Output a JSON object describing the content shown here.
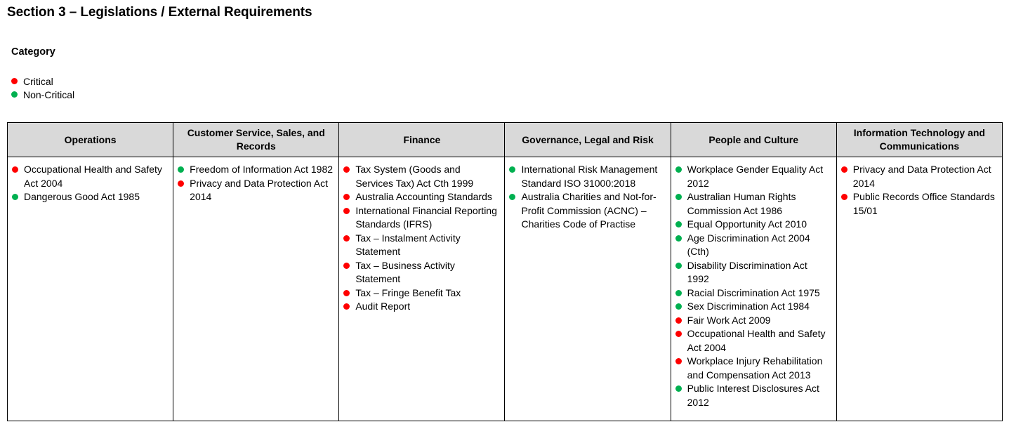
{
  "title": "Section 3 – Legislations / External Requirements",
  "category": {
    "label": "Category",
    "legend": [
      {
        "label": "Critical",
        "status": "critical",
        "color": "#ff0000"
      },
      {
        "label": "Non-Critical",
        "status": "non-critical",
        "color": "#00b050"
      }
    ]
  },
  "table": {
    "columns": [
      {
        "header": "Operations",
        "items": [
          {
            "text": "Occupational Health and Safety Act 2004",
            "status": "critical"
          },
          {
            "text": "Dangerous Good Act 1985",
            "status": "non-critical"
          }
        ]
      },
      {
        "header": "Customer Service, Sales, and Records",
        "items": [
          {
            "text": "Freedom of Information Act 1982",
            "status": "non-critical"
          },
          {
            "text": "Privacy and Data Protection Act 2014",
            "status": "critical"
          }
        ]
      },
      {
        "header": "Finance",
        "items": [
          {
            "text": "Tax System (Goods and Services Tax) Act Cth 1999",
            "status": "critical"
          },
          {
            "text": "Australia Accounting Standards",
            "status": "critical"
          },
          {
            "text": "International Financial Reporting Standards (IFRS)",
            "status": "critical"
          },
          {
            "text": "Tax – Instalment Activity Statement",
            "status": "critical"
          },
          {
            "text": "Tax – Business Activity Statement",
            "status": "critical"
          },
          {
            "text": "Tax – Fringe Benefit Tax",
            "status": "critical"
          },
          {
            "text": "Audit Report",
            "status": "critical"
          }
        ]
      },
      {
        "header": "Governance, Legal and Risk",
        "items": [
          {
            "text": "International Risk Management Standard ISO 31000:2018",
            "status": "non-critical"
          },
          {
            "text": "Australia Charities and Not-for-Profit Commission (ACNC) – Charities Code of Practise",
            "status": "non-critical"
          }
        ]
      },
      {
        "header": "People and Culture",
        "items": [
          {
            "text": "Workplace Gender Equality Act 2012",
            "status": "non-critical"
          },
          {
            "text": "Australian Human Rights Commission Act 1986",
            "status": "non-critical"
          },
          {
            "text": "Equal Opportunity Act 2010",
            "status": "non-critical"
          },
          {
            "text": "Age Discrimination Act 2004 (Cth)",
            "status": "non-critical"
          },
          {
            "text": "Disability Discrimination Act 1992",
            "status": "non-critical"
          },
          {
            "text": "Racial Discrimination Act 1975",
            "status": "non-critical"
          },
          {
            "text": "Sex Discrimination Act 1984",
            "status": "non-critical"
          },
          {
            "text": "Fair Work Act 2009",
            "status": "critical"
          },
          {
            "text": "Occupational Health and Safety Act 2004",
            "status": "critical"
          },
          {
            "text": "Workplace Injury Rehabilitation and Compensation Act 2013",
            "status": "critical"
          },
          {
            "text": "Public Interest Disclosures Act 2012",
            "status": "non-critical"
          }
        ]
      },
      {
        "header": "Information Technology and Communications",
        "items": [
          {
            "text": "Privacy and Data Protection Act 2014",
            "status": "critical"
          },
          {
            "text": "Public Records Office Standards 15/01",
            "status": "critical"
          }
        ]
      }
    ]
  }
}
